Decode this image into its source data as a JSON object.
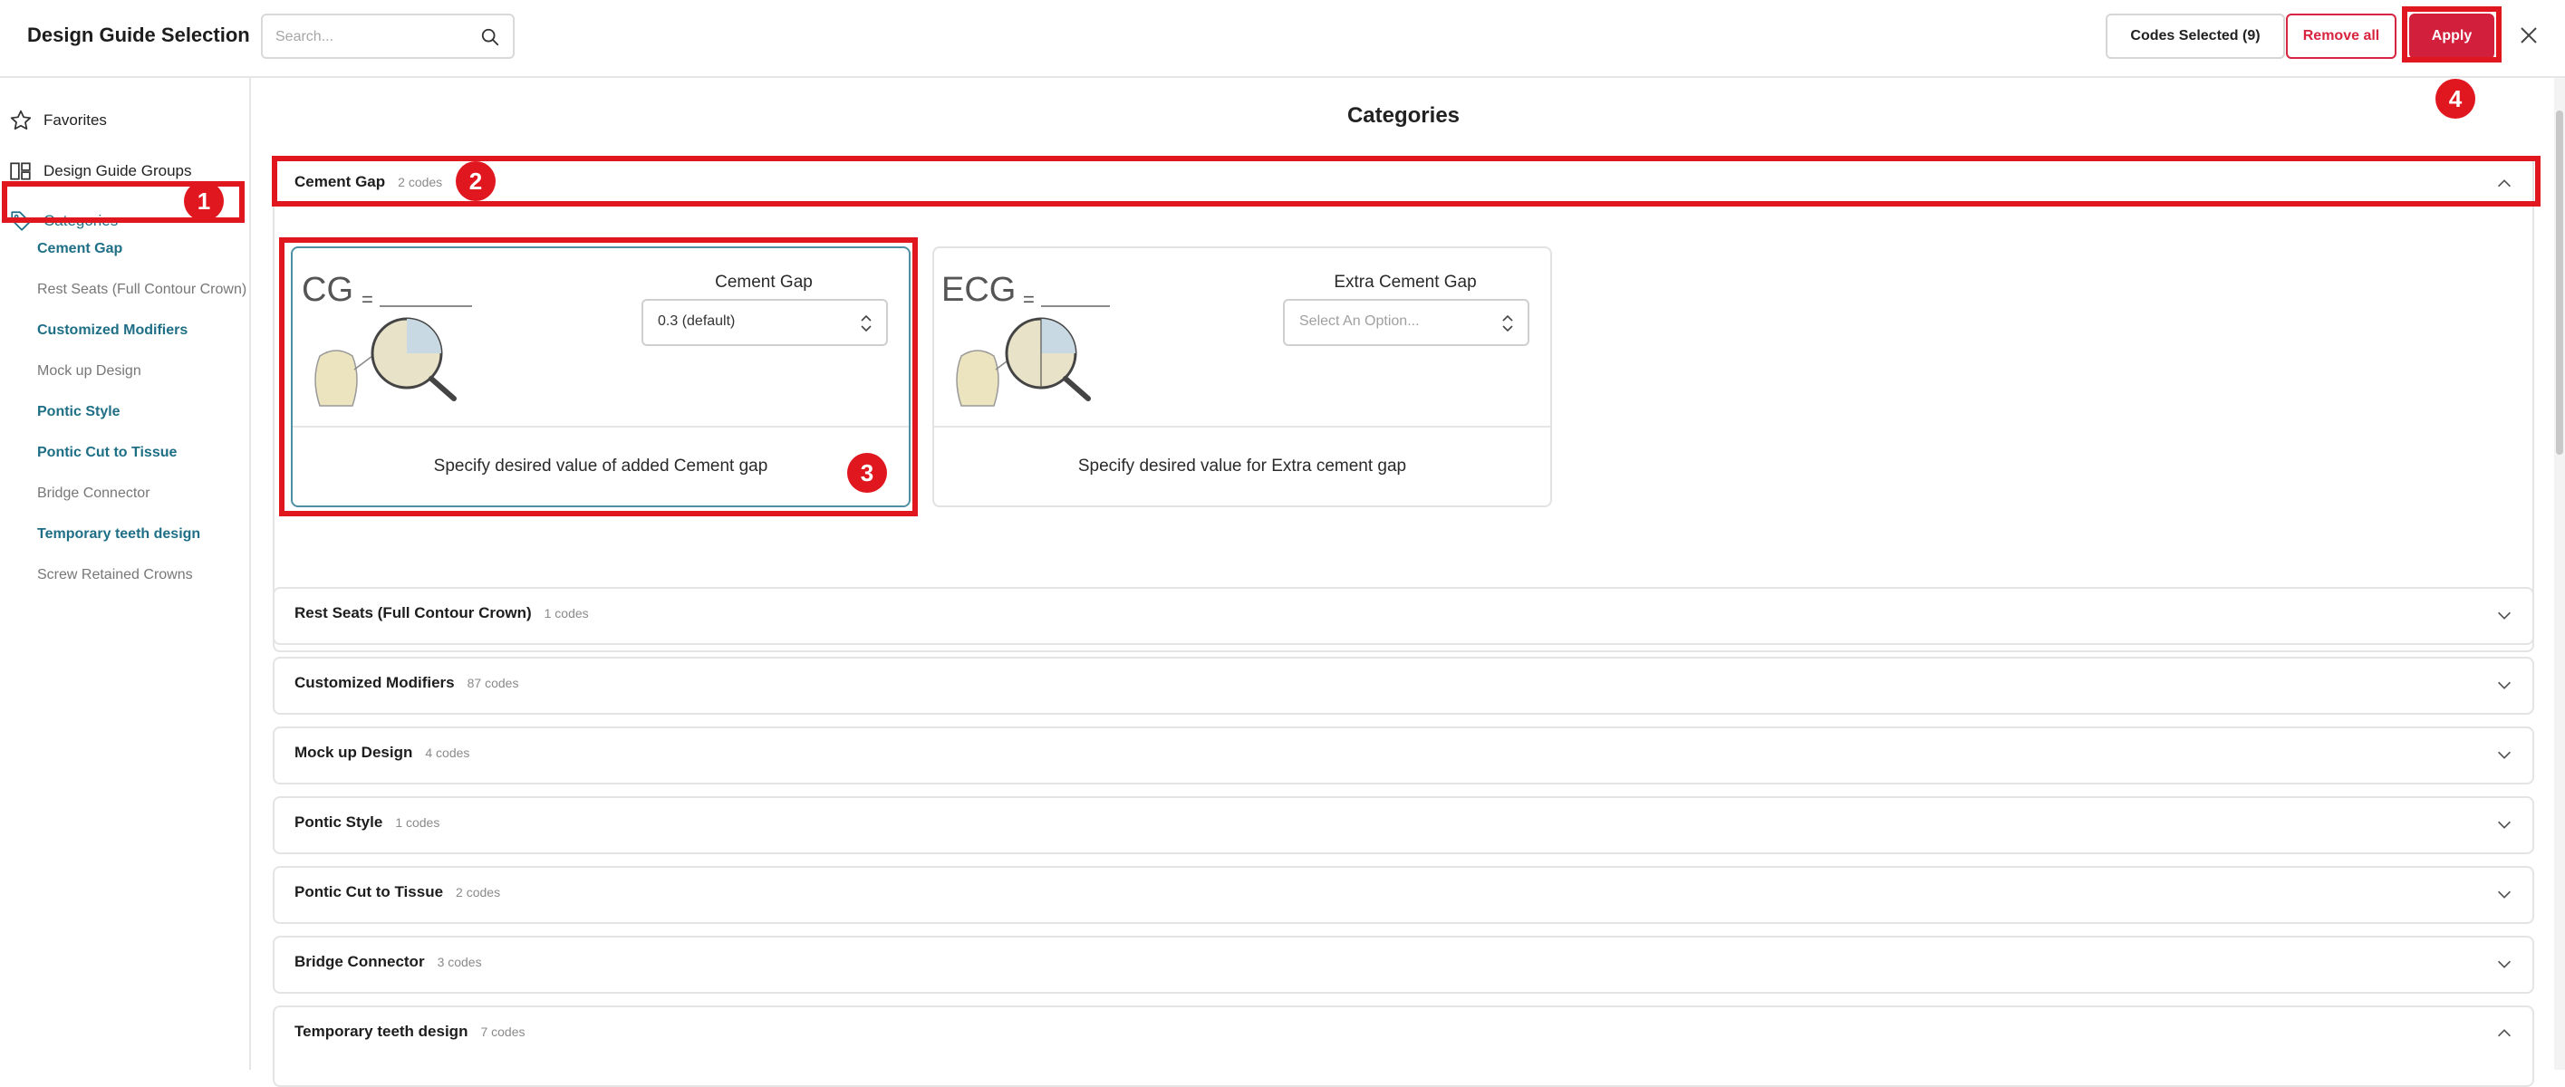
{
  "header": {
    "title": "Design Guide Selection",
    "search_placeholder": "Search...",
    "codes_selected": "Codes Selected (9)",
    "remove_all": "Remove all",
    "apply": "Apply"
  },
  "sidebar": {
    "favorites": "Favorites",
    "design_guide_groups": "Design Guide Groups",
    "categories": "Categories",
    "items": [
      {
        "label": "Cement Gap",
        "state": "active"
      },
      {
        "label": "Rest Seats (Full Contour Crown)",
        "state": "inactive"
      },
      {
        "label": "Customized Modifiers",
        "state": "active"
      },
      {
        "label": "Mock up Design",
        "state": "inactive"
      },
      {
        "label": "Pontic Style",
        "state": "active"
      },
      {
        "label": "Pontic Cut to Tissue",
        "state": "active"
      },
      {
        "label": "Bridge Connector",
        "state": "inactive"
      },
      {
        "label": "Temporary teeth design",
        "state": "active"
      },
      {
        "label": "Screw Retained Crowns",
        "state": "inactive"
      }
    ]
  },
  "main": {
    "heading": "Categories",
    "accordions": [
      {
        "title": "Cement Gap",
        "count": "2 codes",
        "expanded": true
      },
      {
        "title": "Rest Seats (Full Contour Crown)",
        "count": "1 codes",
        "expanded": false
      },
      {
        "title": "Customized Modifiers",
        "count": "87 codes",
        "expanded": false
      },
      {
        "title": "Mock up Design",
        "count": "4 codes",
        "expanded": false
      },
      {
        "title": "Pontic Style",
        "count": "1 codes",
        "expanded": false
      },
      {
        "title": "Pontic Cut to Tissue",
        "count": "2 codes",
        "expanded": false
      },
      {
        "title": "Bridge Connector",
        "count": "3 codes",
        "expanded": false
      },
      {
        "title": "Temporary teeth design",
        "count": "7 codes",
        "expanded": true
      }
    ],
    "cards": [
      {
        "abbr": "CG",
        "equals": "=",
        "label": "Cement Gap",
        "value": "0.3 (default)",
        "description": "Specify desired value of added Cement gap"
      },
      {
        "abbr": "ECG",
        "equals": "=",
        "label": "Extra Cement Gap",
        "placeholder": "Select An Option...",
        "description": "Specify desired value for Extra cement gap"
      }
    ]
  },
  "annotations": {
    "badges": [
      "1",
      "2",
      "3",
      "4"
    ]
  },
  "colors": {
    "accent_teal": "#1e6f86",
    "brand_red": "#d21f3c",
    "annotation_red": "#e0171f"
  }
}
